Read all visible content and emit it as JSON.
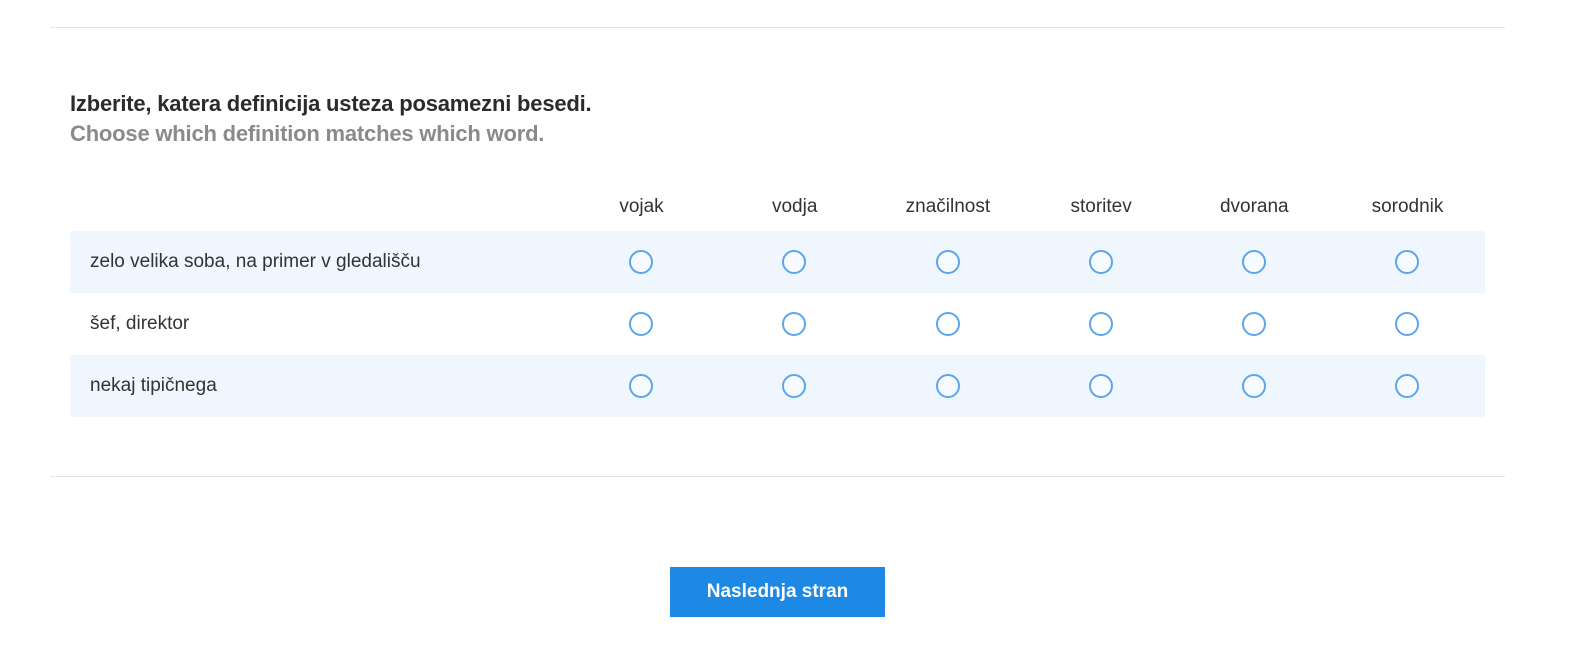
{
  "question": {
    "title": "Izberite, katera definicija usteza posamezni besedi.",
    "subtitle": "Choose which definition matches which word."
  },
  "matrix": {
    "columns": [
      "vojak",
      "vodja",
      "značilnost",
      "storitev",
      "dvorana",
      "sorodnik"
    ],
    "rows": [
      {
        "label": "zelo velika soba, na primer v gledališču"
      },
      {
        "label": "šef, direktor"
      },
      {
        "label": "nekaj tipičnega"
      }
    ]
  },
  "colors": {
    "accent": "#1e88e5",
    "radio_border": "#5ba6ea",
    "row_shade": "#eff6fd"
  },
  "footer": {
    "next_label": "Naslednja stran"
  }
}
